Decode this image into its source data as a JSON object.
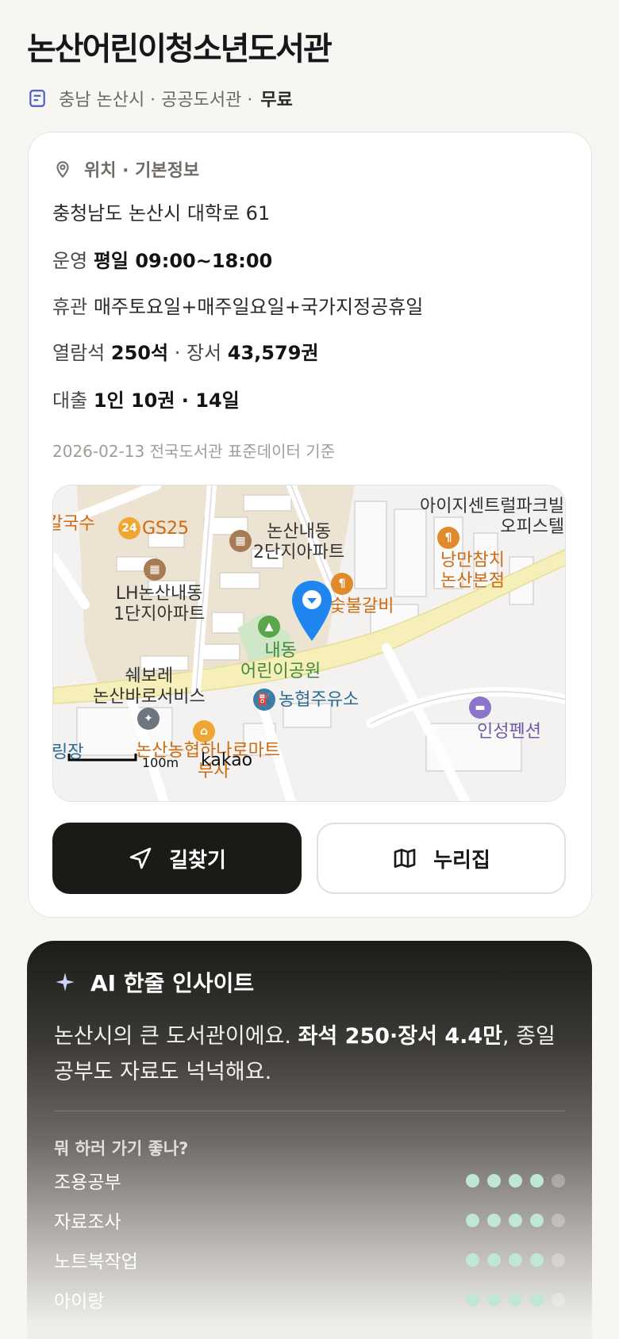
{
  "header": {
    "title": "논산어린이청소년도서관",
    "meta": "충남 논산시 · 공공도서관 ·",
    "fee": "무료"
  },
  "info": {
    "section_title": "위치 · 기본정보",
    "address": "충청남도 논산시 대학로 61",
    "hours_label": "운영",
    "hours_value": "평일 09:00~18:00",
    "closed_label": "휴관",
    "closed_value": "매주토요일+매주일요일+국가지정공휴일",
    "seats_label": "열람석",
    "seats_value": "250석",
    "sep": " · ",
    "books_label": "장서",
    "books_value": "43,579권",
    "loan_label": "대출",
    "loan_value": "1인 10권 · 14일",
    "data_note": "2026-02-13 전국도서관 표준데이터 기준"
  },
  "map": {
    "labels": {
      "gs25": "GS25",
      "kalguksu": "칼국수",
      "nonsan_apt2_l1": "논산내동",
      "nonsan_apt2_l2": "2단지아파트",
      "ijisent_l1": "아이지센트럴파크빌",
      "ijisent_l2": "오피스텔",
      "nangman_l1": "낭만참치",
      "nangman_l2": "논산본점",
      "lh_l1": "LH논산내동",
      "lh_l2": "1단지아파트",
      "galbi": "큰가숯불갈비",
      "park_l1": "내동",
      "park_l2": "어린이공원",
      "shwebore_l1": "쉐보레",
      "shwebore_l2": "논산바로서비스",
      "nonghyup_gas": "농협주유소",
      "pension": "인성펜션",
      "mart": "논산농협하나로마트",
      "busa": "부사",
      "edge_left": "링장",
      "scale": "100m",
      "provider": "kakao"
    },
    "colors": {
      "residential": "#ece3d3",
      "road_main": "#f6efb9",
      "park": "#cfe6c7",
      "marker": "#1f86f0"
    }
  },
  "buttons": {
    "directions": "길찾기",
    "nurijip": "누리집"
  },
  "ai": {
    "title": "AI 한줄 인사이트",
    "text_start": "논산시의 큰 도서관이에요. ",
    "text_bold": "좌석 250·장서 4.4만",
    "text_end": ", 종일 공부도 자료도 넉넉해요.",
    "question": "뭐 하러 가기 좋나?",
    "ratings": [
      {
        "label": "조용공부",
        "score": 4,
        "max": 5
      },
      {
        "label": "자료조사",
        "score": 4,
        "max": 5
      },
      {
        "label": "노트북작업",
        "score": 4,
        "max": 5
      },
      {
        "label": "아이랑",
        "score": 4,
        "max": 5
      }
    ],
    "accent": "#bfe6d6"
  }
}
